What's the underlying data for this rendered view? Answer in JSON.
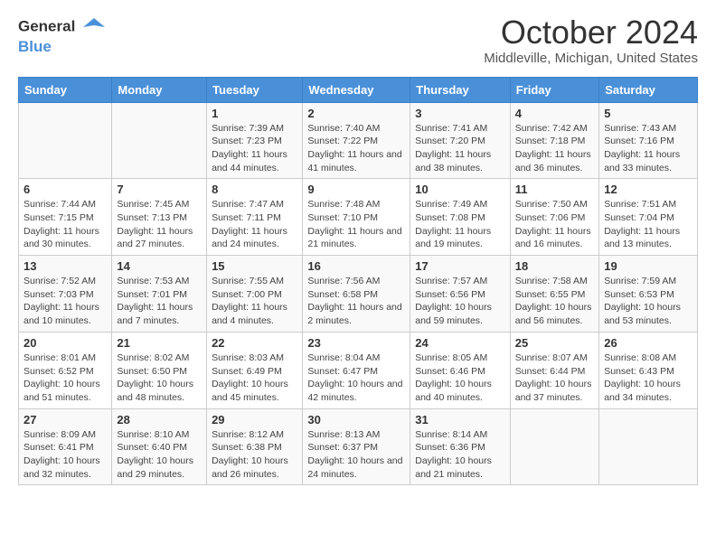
{
  "header": {
    "logo_line1": "General",
    "logo_line2": "Blue",
    "title": "October 2024",
    "subtitle": "Middleville, Michigan, United States"
  },
  "days_of_week": [
    "Sunday",
    "Monday",
    "Tuesday",
    "Wednesday",
    "Thursday",
    "Friday",
    "Saturday"
  ],
  "weeks": [
    [
      {
        "day": "",
        "sunrise": "",
        "sunset": "",
        "daylight": ""
      },
      {
        "day": "",
        "sunrise": "",
        "sunset": "",
        "daylight": ""
      },
      {
        "day": "1",
        "sunrise": "Sunrise: 7:39 AM",
        "sunset": "Sunset: 7:23 PM",
        "daylight": "Daylight: 11 hours and 44 minutes."
      },
      {
        "day": "2",
        "sunrise": "Sunrise: 7:40 AM",
        "sunset": "Sunset: 7:22 PM",
        "daylight": "Daylight: 11 hours and 41 minutes."
      },
      {
        "day": "3",
        "sunrise": "Sunrise: 7:41 AM",
        "sunset": "Sunset: 7:20 PM",
        "daylight": "Daylight: 11 hours and 38 minutes."
      },
      {
        "day": "4",
        "sunrise": "Sunrise: 7:42 AM",
        "sunset": "Sunset: 7:18 PM",
        "daylight": "Daylight: 11 hours and 36 minutes."
      },
      {
        "day": "5",
        "sunrise": "Sunrise: 7:43 AM",
        "sunset": "Sunset: 7:16 PM",
        "daylight": "Daylight: 11 hours and 33 minutes."
      }
    ],
    [
      {
        "day": "6",
        "sunrise": "Sunrise: 7:44 AM",
        "sunset": "Sunset: 7:15 PM",
        "daylight": "Daylight: 11 hours and 30 minutes."
      },
      {
        "day": "7",
        "sunrise": "Sunrise: 7:45 AM",
        "sunset": "Sunset: 7:13 PM",
        "daylight": "Daylight: 11 hours and 27 minutes."
      },
      {
        "day": "8",
        "sunrise": "Sunrise: 7:47 AM",
        "sunset": "Sunset: 7:11 PM",
        "daylight": "Daylight: 11 hours and 24 minutes."
      },
      {
        "day": "9",
        "sunrise": "Sunrise: 7:48 AM",
        "sunset": "Sunset: 7:10 PM",
        "daylight": "Daylight: 11 hours and 21 minutes."
      },
      {
        "day": "10",
        "sunrise": "Sunrise: 7:49 AM",
        "sunset": "Sunset: 7:08 PM",
        "daylight": "Daylight: 11 hours and 19 minutes."
      },
      {
        "day": "11",
        "sunrise": "Sunrise: 7:50 AM",
        "sunset": "Sunset: 7:06 PM",
        "daylight": "Daylight: 11 hours and 16 minutes."
      },
      {
        "day": "12",
        "sunrise": "Sunrise: 7:51 AM",
        "sunset": "Sunset: 7:04 PM",
        "daylight": "Daylight: 11 hours and 13 minutes."
      }
    ],
    [
      {
        "day": "13",
        "sunrise": "Sunrise: 7:52 AM",
        "sunset": "Sunset: 7:03 PM",
        "daylight": "Daylight: 11 hours and 10 minutes."
      },
      {
        "day": "14",
        "sunrise": "Sunrise: 7:53 AM",
        "sunset": "Sunset: 7:01 PM",
        "daylight": "Daylight: 11 hours and 7 minutes."
      },
      {
        "day": "15",
        "sunrise": "Sunrise: 7:55 AM",
        "sunset": "Sunset: 7:00 PM",
        "daylight": "Daylight: 11 hours and 4 minutes."
      },
      {
        "day": "16",
        "sunrise": "Sunrise: 7:56 AM",
        "sunset": "Sunset: 6:58 PM",
        "daylight": "Daylight: 11 hours and 2 minutes."
      },
      {
        "day": "17",
        "sunrise": "Sunrise: 7:57 AM",
        "sunset": "Sunset: 6:56 PM",
        "daylight": "Daylight: 10 hours and 59 minutes."
      },
      {
        "day": "18",
        "sunrise": "Sunrise: 7:58 AM",
        "sunset": "Sunset: 6:55 PM",
        "daylight": "Daylight: 10 hours and 56 minutes."
      },
      {
        "day": "19",
        "sunrise": "Sunrise: 7:59 AM",
        "sunset": "Sunset: 6:53 PM",
        "daylight": "Daylight: 10 hours and 53 minutes."
      }
    ],
    [
      {
        "day": "20",
        "sunrise": "Sunrise: 8:01 AM",
        "sunset": "Sunset: 6:52 PM",
        "daylight": "Daylight: 10 hours and 51 minutes."
      },
      {
        "day": "21",
        "sunrise": "Sunrise: 8:02 AM",
        "sunset": "Sunset: 6:50 PM",
        "daylight": "Daylight: 10 hours and 48 minutes."
      },
      {
        "day": "22",
        "sunrise": "Sunrise: 8:03 AM",
        "sunset": "Sunset: 6:49 PM",
        "daylight": "Daylight: 10 hours and 45 minutes."
      },
      {
        "day": "23",
        "sunrise": "Sunrise: 8:04 AM",
        "sunset": "Sunset: 6:47 PM",
        "daylight": "Daylight: 10 hours and 42 minutes."
      },
      {
        "day": "24",
        "sunrise": "Sunrise: 8:05 AM",
        "sunset": "Sunset: 6:46 PM",
        "daylight": "Daylight: 10 hours and 40 minutes."
      },
      {
        "day": "25",
        "sunrise": "Sunrise: 8:07 AM",
        "sunset": "Sunset: 6:44 PM",
        "daylight": "Daylight: 10 hours and 37 minutes."
      },
      {
        "day": "26",
        "sunrise": "Sunrise: 8:08 AM",
        "sunset": "Sunset: 6:43 PM",
        "daylight": "Daylight: 10 hours and 34 minutes."
      }
    ],
    [
      {
        "day": "27",
        "sunrise": "Sunrise: 8:09 AM",
        "sunset": "Sunset: 6:41 PM",
        "daylight": "Daylight: 10 hours and 32 minutes."
      },
      {
        "day": "28",
        "sunrise": "Sunrise: 8:10 AM",
        "sunset": "Sunset: 6:40 PM",
        "daylight": "Daylight: 10 hours and 29 minutes."
      },
      {
        "day": "29",
        "sunrise": "Sunrise: 8:12 AM",
        "sunset": "Sunset: 6:38 PM",
        "daylight": "Daylight: 10 hours and 26 minutes."
      },
      {
        "day": "30",
        "sunrise": "Sunrise: 8:13 AM",
        "sunset": "Sunset: 6:37 PM",
        "daylight": "Daylight: 10 hours and 24 minutes."
      },
      {
        "day": "31",
        "sunrise": "Sunrise: 8:14 AM",
        "sunset": "Sunset: 6:36 PM",
        "daylight": "Daylight: 10 hours and 21 minutes."
      },
      {
        "day": "",
        "sunrise": "",
        "sunset": "",
        "daylight": ""
      },
      {
        "day": "",
        "sunrise": "",
        "sunset": "",
        "daylight": ""
      }
    ]
  ]
}
